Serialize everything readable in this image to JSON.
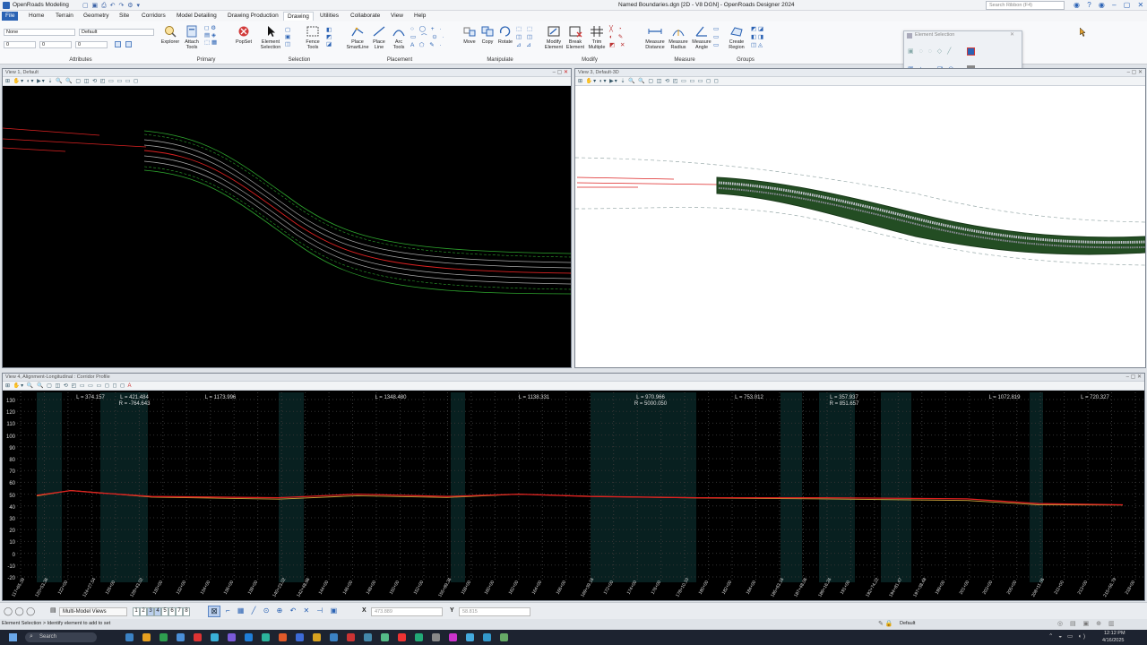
{
  "title": {
    "workflow": "OpenRoads Modeling",
    "document": "Named Boundaries.dgn [2D - V8 DGN] - OpenRoads Designer 2024",
    "search_placeholder": "Search Ribbon (F4)"
  },
  "menu": [
    "File",
    "Home",
    "Terrain",
    "Geometry",
    "Site",
    "Corridors",
    "Model Detailing",
    "Drawing Production",
    "Drawing",
    "Utilities",
    "Collaborate",
    "View",
    "Help"
  ],
  "ribbon": {
    "attributes": {
      "label": "Attributes",
      "level": "None",
      "style": "Default",
      "weight": "0",
      "color": "0",
      "transparency": "0"
    },
    "primary": {
      "label": "Primary",
      "explorer": "Explorer",
      "attach_tools": "Attach Tools",
      "popset": "PopSet"
    },
    "selection": {
      "label": "Selection",
      "element_selection": "Element Selection",
      "fence_tools": "Fence Tools"
    },
    "placement": {
      "label": "Placement",
      "smartline": "Place SmartLine",
      "line": "Place Line",
      "arc": "Arc Tools"
    },
    "manipulate": {
      "label": "Manipulate",
      "move": "Move",
      "copy": "Copy",
      "rotate": "Rotate"
    },
    "modify": {
      "label": "Modify",
      "modify_element": "Modify Element",
      "break_element": "Break Element",
      "trim_multiple": "Trim Multiple"
    },
    "measure": {
      "label": "Measure",
      "distance": "Measure Distance",
      "radius": "Measure Radius",
      "angle": "Measure Angle"
    },
    "groups": {
      "label": "Groups",
      "create_region": "Create Region"
    }
  },
  "element_selection": {
    "title": "Element Selection"
  },
  "views": {
    "v1": {
      "title": "View 1, Default"
    },
    "v3": {
      "title": "View 3, Default-3D"
    },
    "v4": {
      "title": "View 4, Alignment-Longitudinal : Corridor Profile"
    }
  },
  "profile": {
    "y_ticks": [
      "130",
      "120",
      "110",
      "100",
      "90",
      "80",
      "70",
      "60",
      "50",
      "40",
      "30",
      "20",
      "10",
      "0",
      "-10",
      "-20"
    ],
    "segments": [
      {
        "l": "L = 374.157",
        "r": ""
      },
      {
        "l": "L = 421.484",
        "r": "R = -764.643"
      },
      {
        "l": "L = 1173.996",
        "r": ""
      },
      {
        "l": "L = 1348.480",
        "r": ""
      },
      {
        "l": "L = 1138.331",
        "r": ""
      },
      {
        "l": "L = 970.966",
        "r": "R = 5000.050"
      },
      {
        "l": "L = 753.012",
        "r": ""
      },
      {
        "l": "L = 357.937",
        "r": "R = 851.657"
      },
      {
        "l": "L = 1072.819",
        "r": ""
      },
      {
        "l": "L = 720.327",
        "r": ""
      }
    ],
    "stations": [
      "117+65.39",
      "120+53.36",
      "122+00",
      "124+27.54",
      "126+00",
      "128+43.02",
      "130+00",
      "132+00",
      "134+00",
      "136+00",
      "138+00",
      "140+23.02",
      "142+48.96",
      "144+00",
      "146+00",
      "148+00",
      "150+00",
      "152+00",
      "155+89.36",
      "158+00",
      "160+00",
      "162+00",
      "164+00",
      "166+00",
      "169+39.16",
      "172+00",
      "174+00",
      "176+00",
      "178+10.10",
      "180+00",
      "182+00",
      "184+00",
      "185+63.16",
      "187+48.06",
      "189+16.26",
      "191+00",
      "192+74.22",
      "194+81.47",
      "197+38.48",
      "199+00",
      "201+00",
      "203+00",
      "205+00",
      "208+11.06",
      "211+00",
      "213+00",
      "215+56.79",
      "218+00"
    ]
  },
  "status": {
    "view_group": "Multi-Model Views",
    "view_numbers": [
      "1",
      "2",
      "3",
      "4",
      "5",
      "6",
      "7",
      "8"
    ],
    "x_label": "X",
    "x_value": "473.889",
    "y_label": "Y",
    "y_value": "58.815",
    "prompt": "Element Selection > Identify element to add to set",
    "level": "Default"
  },
  "taskbar": {
    "search": "Search",
    "time": "12:12 PM",
    "date": "4/16/2025"
  },
  "colors": {
    "accent": "#2b63b4",
    "alignment": "#e02020",
    "corridor": "#2ea52e"
  }
}
